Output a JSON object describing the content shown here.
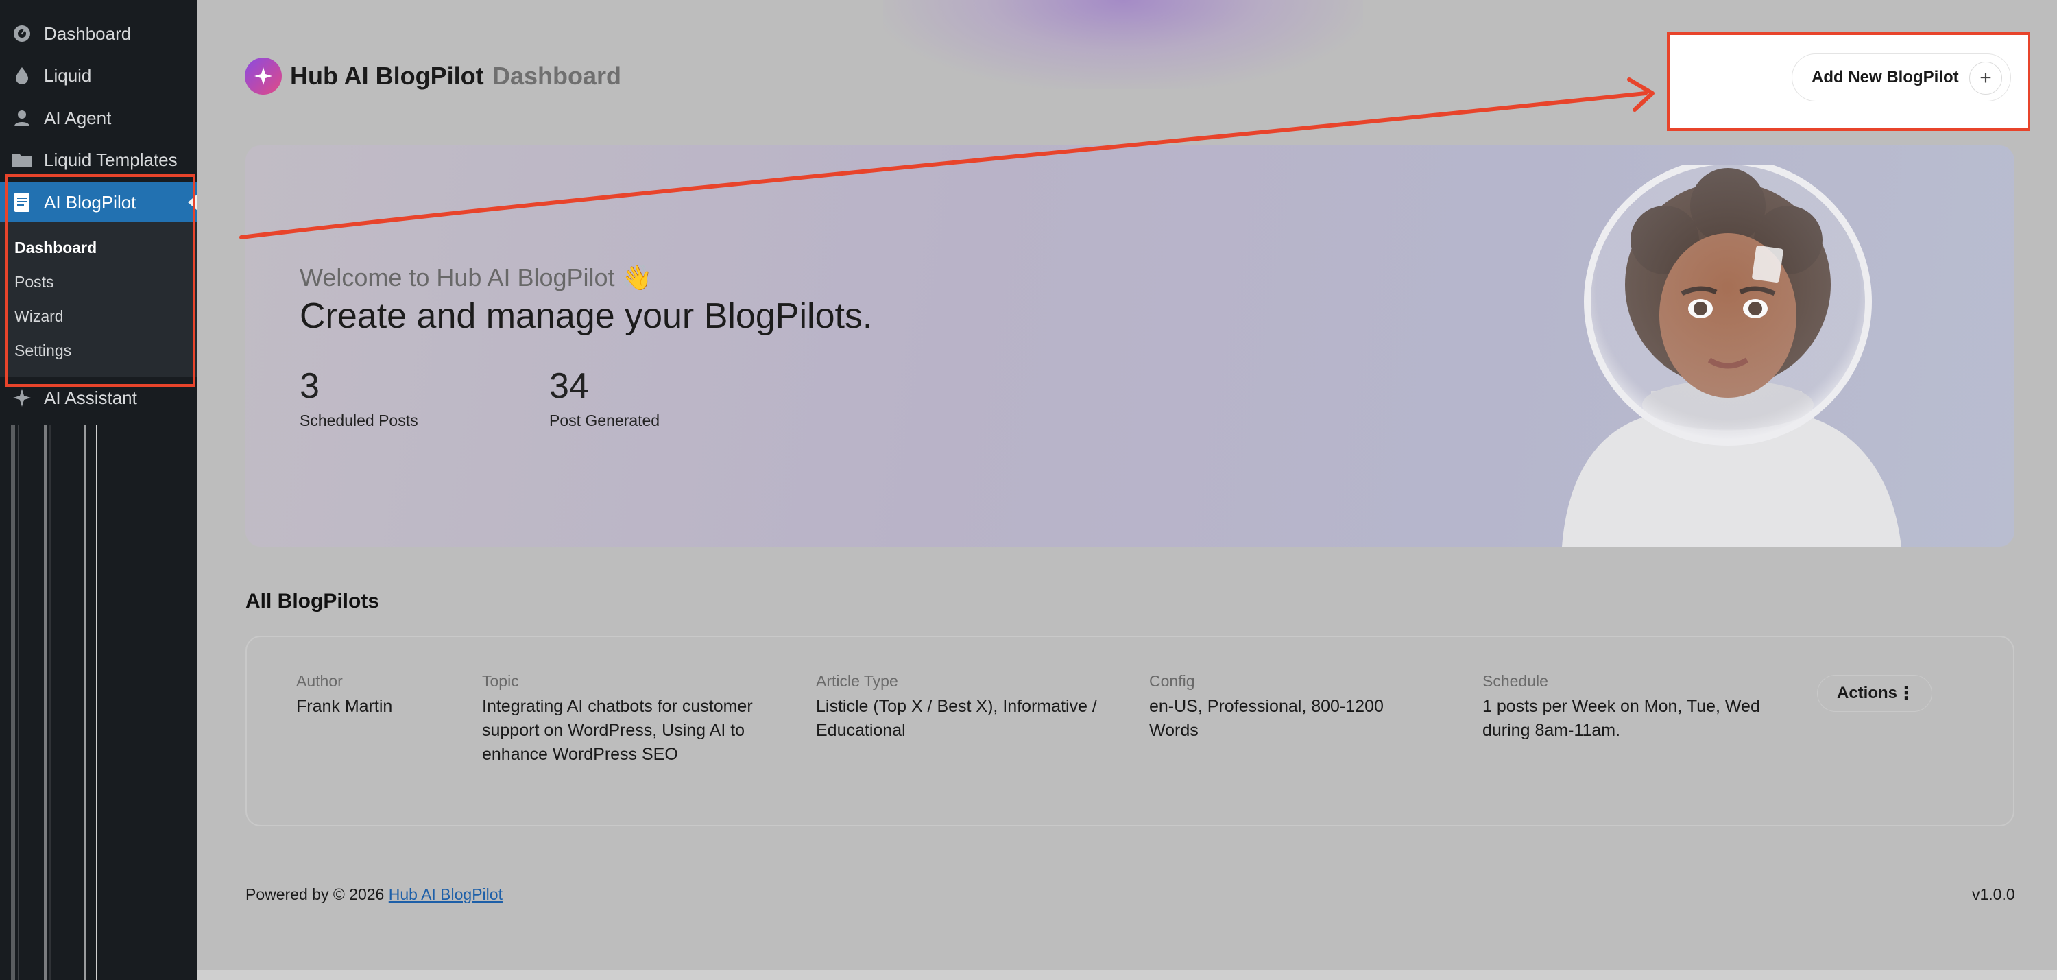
{
  "sidebar": {
    "items": [
      {
        "label": "Dashboard",
        "icon": "dashboard-gauge-icon"
      },
      {
        "label": "Liquid",
        "icon": "drop-icon"
      },
      {
        "label": "AI Agent",
        "icon": "user-icon"
      },
      {
        "label": "Liquid Templates",
        "icon": "folder-icon"
      },
      {
        "label": "AI BlogPilot",
        "icon": "document-icon"
      },
      {
        "label": "AI Assistant",
        "icon": "sparkle-icon"
      }
    ],
    "submenu": [
      "Dashboard",
      "Posts",
      "Wizard",
      "Settings"
    ]
  },
  "header": {
    "app_title": "Hub AI BlogPilot",
    "page_name": "Dashboard",
    "add_button_label": "Add New BlogPilot",
    "add_button_icon": "+"
  },
  "hero": {
    "welcome": "Welcome to Hub AI BlogPilot 👋",
    "headline": "Create and manage your BlogPilots.",
    "stats": [
      {
        "value": "3",
        "label": "Scheduled Posts"
      },
      {
        "value": "34",
        "label": "Post Generated"
      }
    ]
  },
  "blogpilots": {
    "title": "All BlogPilots",
    "columns": [
      "Author",
      "Topic",
      "Article Type",
      "Config",
      "Schedule"
    ],
    "rows": [
      {
        "author": "Frank Martin",
        "topic": "Integrating AI chatbots for customer support on WordPress, Using AI to enhance WordPress SEO",
        "article_type": "Listicle (Top X / Best X), Informative / Educational",
        "config": "en-US, Professional, 800-1200 Words",
        "schedule": "1 posts per Week on Mon, Tue, Wed during 8am-11am.",
        "actions_label": "Actions"
      }
    ]
  },
  "footer": {
    "powered_prefix": "Powered by © 2026",
    "powered_link": "Hub AI BlogPilot",
    "version": "v1.0.0"
  },
  "colors": {
    "wp_blue": "#2271b1",
    "highlight_red": "#e8442b",
    "sidebar_bg": "#181c20"
  }
}
